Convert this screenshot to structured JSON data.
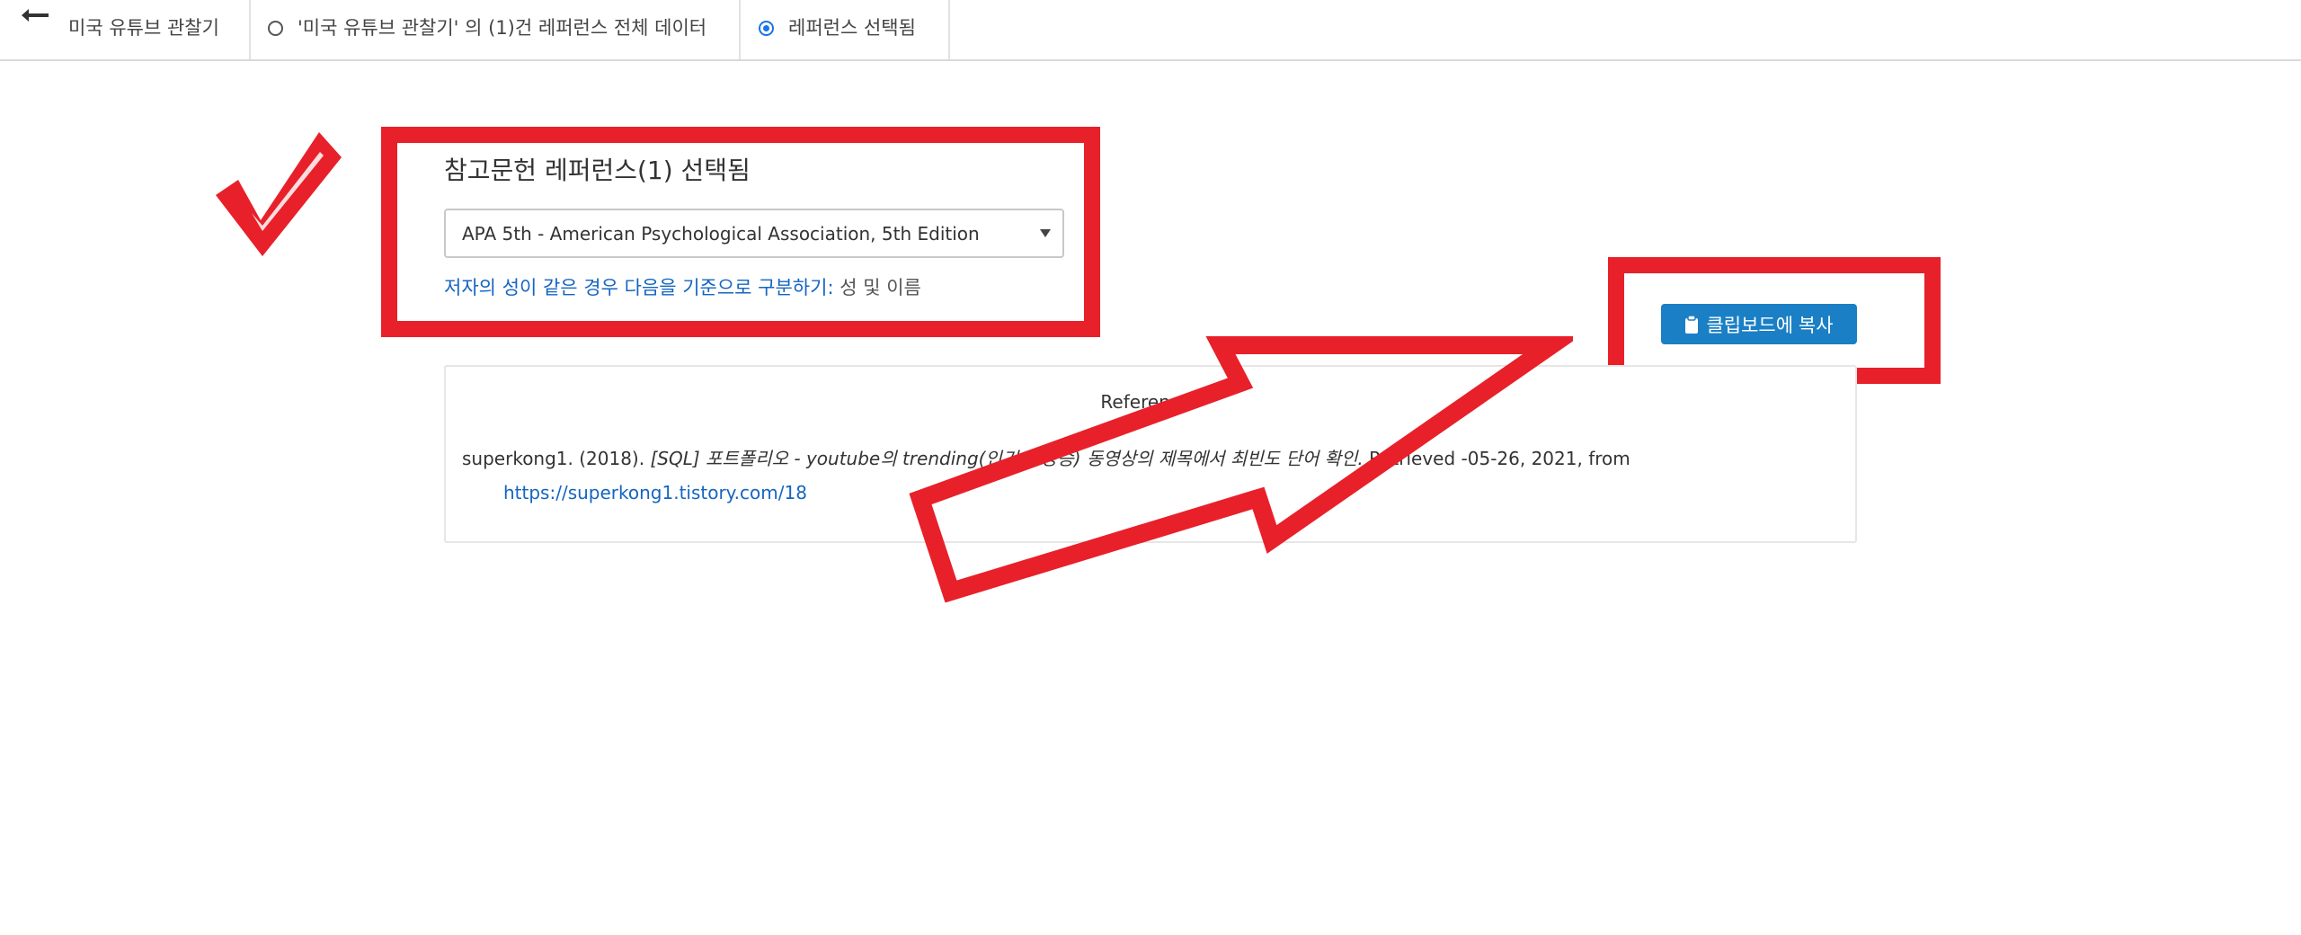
{
  "topbar": {
    "back_icon": "arrow-left-icon",
    "project_title": "미국 유튜브 관찰기",
    "option_all": "'미국 유튜브 관찰기' 의 (1)건 레퍼런스 전체 데이터",
    "option_selected": "레퍼런스 선택됨",
    "selected_option": "option_selected"
  },
  "panel": {
    "title": "참고문헌 레퍼런스(1) 선택됨",
    "citation_style": "APA 5th - American Psychological Association, 5th Edition",
    "name_rule_label": "저자의 성이 같은 경우 다음을 기준으로 구분하기:",
    "name_rule_value": "성 및 이름"
  },
  "copy_button": {
    "label": "클립보드에 복사",
    "icon": "clipboard-icon",
    "color": "#1a7fc4"
  },
  "references": {
    "heading": "References",
    "entry_author": "superkong1. (2018).",
    "entry_title": "[SQL] 포트폴리오 - youtube의 trending(인기 급상승) 동영상의 제목에서 최빈도 단어 확인.",
    "entry_retrieved": "Retrieved -05-26, 2021, from",
    "entry_url": "https://superkong1.tistory.com/18"
  },
  "annotations": {
    "color": "#e8202a",
    "marks": [
      "checkmark-icon",
      "highlight-box",
      "highlight-box",
      "arrow-icon"
    ]
  }
}
